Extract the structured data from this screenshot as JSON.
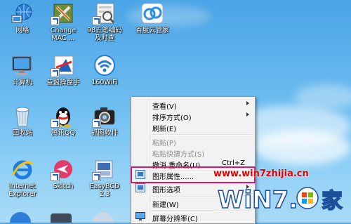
{
  "desktop": {
    "icons": [
      {
        "label": "网络",
        "icon": "network-icon"
      },
      {
        "label": "Change\nMAC ...",
        "icon": "change-mac-icon"
      },
      {
        "label": "98五笔编码\n及时查",
        "icon": "wubi-icon"
      },
      {
        "label": "百度云管家",
        "icon": "baidu-cloud-icon"
      },
      {
        "label": "计算机",
        "icon": "computer-icon"
      },
      {
        "label": "益盟操盘手",
        "icon": "yimeng-icon"
      },
      {
        "label": "160WiFi",
        "icon": "wifi-icon"
      },
      {
        "label": "回收站",
        "icon": "recycle-bin-icon"
      },
      {
        "label": "腾讯QQ",
        "icon": "qq-icon"
      },
      {
        "label": "抓图软件",
        "icon": "camera-icon"
      },
      {
        "label": "Internet\nExplorer",
        "icon": "ie-icon"
      },
      {
        "label": "Skitch",
        "icon": "skitch-icon"
      },
      {
        "label": "EasyBCD\n2.3",
        "icon": "easybcd-icon"
      }
    ]
  },
  "context_menu": {
    "items": [
      {
        "label": "查看(V)",
        "submenu": true,
        "disabled": false
      },
      {
        "label": "排序方式(O)",
        "submenu": true,
        "disabled": false
      },
      {
        "label": "刷新(E)",
        "submenu": false,
        "disabled": false
      },
      {
        "label": "粘贴(P)",
        "submenu": false,
        "disabled": true
      },
      {
        "label": "粘贴快捷方式(S)",
        "submenu": false,
        "disabled": true
      },
      {
        "label": "撤消 重命名(U)",
        "shortcut": "Ctrl+Z",
        "submenu": false,
        "disabled": false
      },
      {
        "label": "图形属性......",
        "submenu": false,
        "disabled": false,
        "highlighted": true
      },
      {
        "label": "图形选项",
        "submenu": true,
        "disabled": false
      },
      {
        "label": "新建(W)",
        "submenu": true,
        "disabled": false
      },
      {
        "label": "屏幕分辨率(C)",
        "submenu": false,
        "disabled": false
      }
    ],
    "highlight_color": "#e0136a"
  },
  "watermark": {
    "url": "www.win7zhijia.cn",
    "logo_text": "WiN7.",
    "logo_suffix": "家"
  }
}
